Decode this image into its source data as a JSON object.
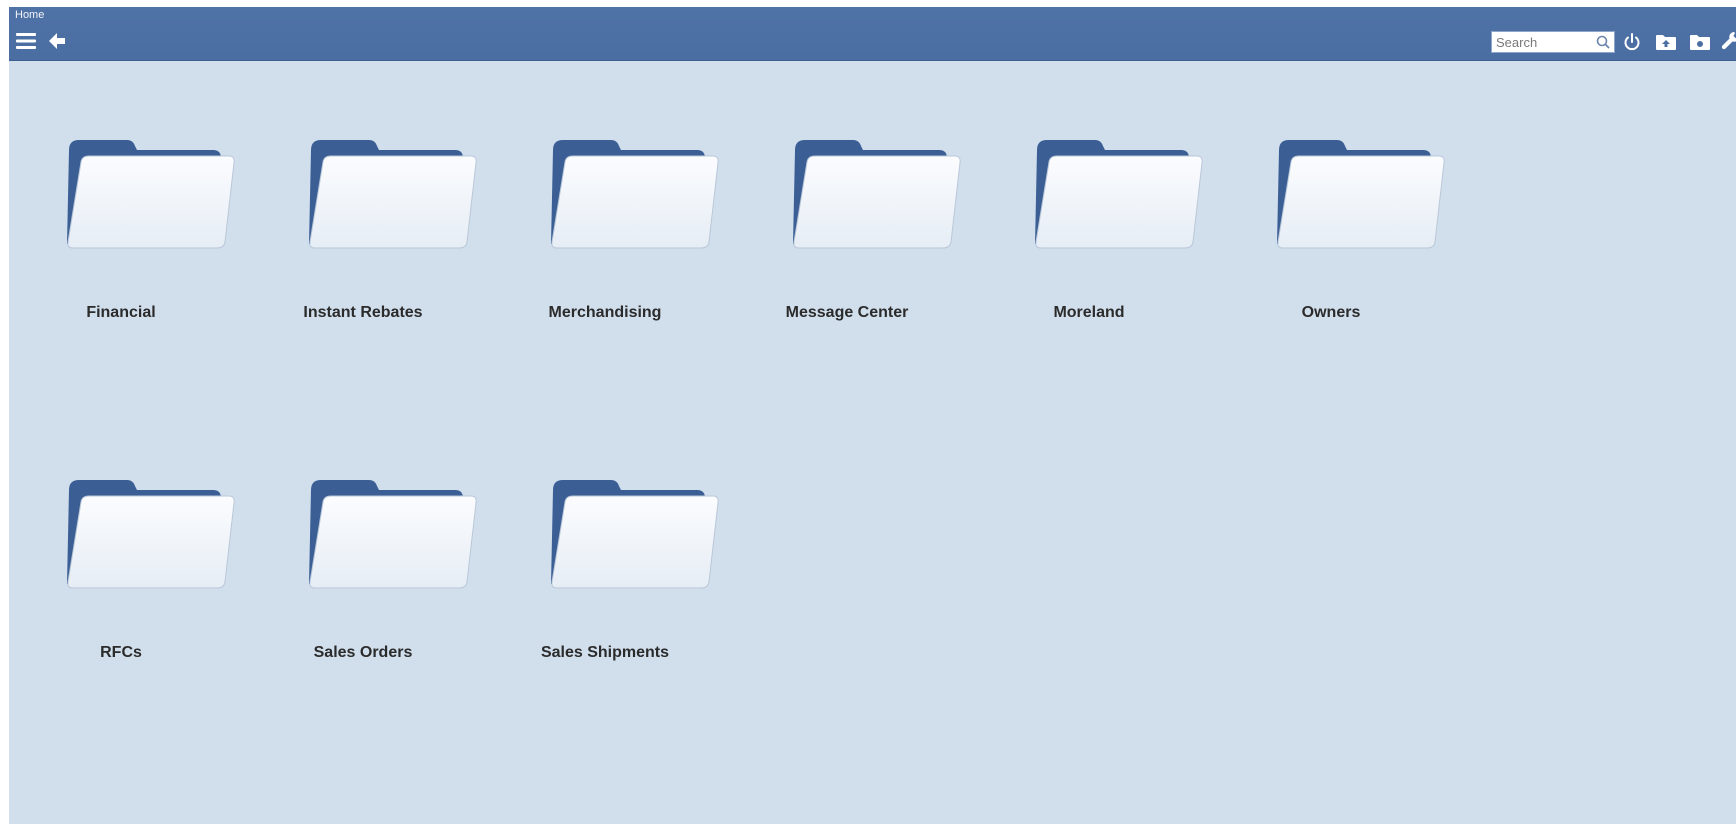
{
  "breadcrumb": "Home",
  "toolbar": {
    "menu_icon": "hamburger-menu-icon",
    "back_icon": "back-arrow-icon",
    "search_placeholder": "Search",
    "search_icon": "search-icon",
    "power_icon": "power-icon",
    "folder_up_icon": "folder-up-icon",
    "folder_icon": "folder-icon",
    "wrench_icon": "wrench-icon"
  },
  "colors": {
    "header": "#4c6fa4",
    "background": "#d1dfed",
    "folder_back": "#3b5f95",
    "label": "#2b2b2b"
  },
  "folders": [
    {
      "label": "Financial"
    },
    {
      "label": "Instant Rebates"
    },
    {
      "label": "Merchandising"
    },
    {
      "label": "Message Center"
    },
    {
      "label": "Moreland"
    },
    {
      "label": "Owners"
    },
    {
      "label": "RFCs"
    },
    {
      "label": "Sales Orders"
    },
    {
      "label": "Sales Shipments"
    }
  ]
}
